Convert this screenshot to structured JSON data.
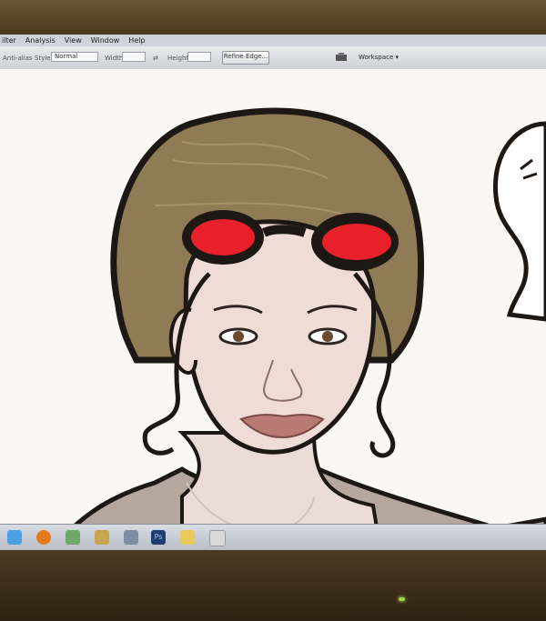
{
  "window": {
    "title": ""
  },
  "menu": {
    "items": [
      "ilter",
      "Analysis",
      "View",
      "Window",
      "Help"
    ]
  },
  "options": {
    "tool_label": "Anti-alias",
    "style_label": "Style:",
    "style_value": "Normal",
    "width_label": "Width:",
    "height_label": "Height:",
    "refine_button": "Refine Edge...",
    "workspace_label": "Workspace ▾"
  },
  "taskbar": {
    "icons": [
      "ie-icon",
      "firefox-icon",
      "explorer-icon",
      "mail-icon",
      "photoshop-icon",
      "folder-icon",
      "game-icon"
    ]
  },
  "colors": {
    "goggle_red": "#e8202a",
    "hair": "#8f7b55",
    "skin": "#f0dcd7",
    "lips": "#b87a72",
    "outline": "#1e1814"
  }
}
